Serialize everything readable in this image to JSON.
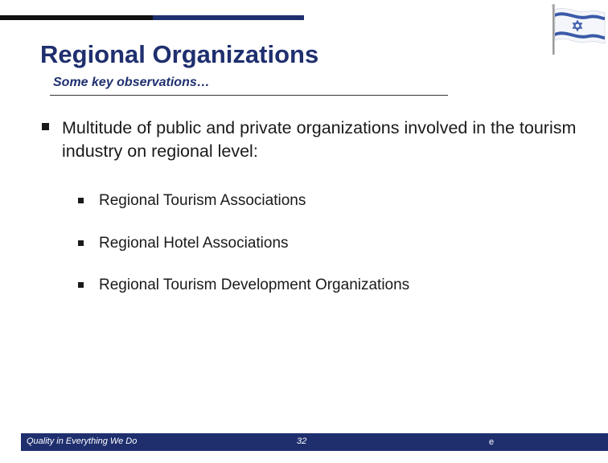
{
  "slide": {
    "title": "Regional Organizations",
    "subtitle": "Some key observations…",
    "main_bullet": "Multitude of public and private organizations involved in the tourism industry on regional level:",
    "sub_bullets": [
      "Regional Tourism Associations",
      "Regional Hotel Associations",
      "Regional Tourism Development Organizations"
    ]
  },
  "footer": {
    "motto": "Quality in Everything We Do",
    "page_number": "32",
    "mark": "e"
  },
  "colors": {
    "brand_navy": "#1f2f6e",
    "top_bar_black": "#111111"
  },
  "icons": {
    "flag": "israel-flag-icon"
  }
}
